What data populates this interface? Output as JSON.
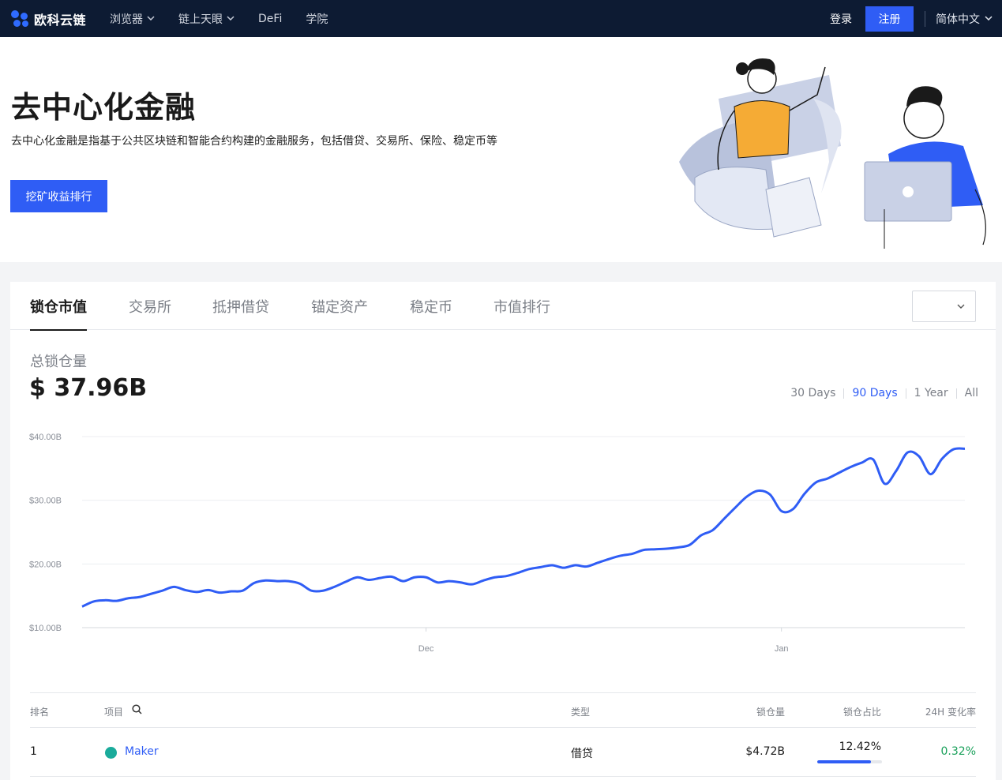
{
  "nav": {
    "brand": "欧科云链",
    "menu": [
      {
        "label": "浏览器",
        "dropdown": true
      },
      {
        "label": "链上天眼",
        "dropdown": true
      },
      {
        "label": "DeFi",
        "dropdown": false
      },
      {
        "label": "学院",
        "dropdown": false
      }
    ],
    "login": "登录",
    "signup": "注册",
    "language": "简体中文"
  },
  "hero": {
    "title": "去中心化金融",
    "description": "去中心化金融是指基于公共区块链和智能合约构建的金融服务，包括借贷、交易所、保险、稳定币等",
    "button": "挖矿收益排行"
  },
  "tabs": [
    "锁仓市值",
    "交易所",
    "抵押借贷",
    "锚定资产",
    "稳定币",
    "市值排行"
  ],
  "active_tab": 0,
  "tvl": {
    "label": "总锁仓量",
    "value": "$ 37.96B"
  },
  "ranges": [
    "30 Days",
    "90 Days",
    "1 Year",
    "All"
  ],
  "active_range": 1,
  "colors": {
    "accent": "#2f5df5",
    "nav_bg": "#0d1b33",
    "positive": "#19a05a"
  },
  "chart_data": {
    "type": "line",
    "ylim": [
      10,
      40
    ],
    "y_ticks": [
      10,
      20,
      30,
      40
    ],
    "y_tick_labels": [
      "$10.00B",
      "$20.00B",
      "$30.00B",
      "$40.00B"
    ],
    "x_tick_labels": [
      {
        "label": "Dec",
        "index": 30
      },
      {
        "label": "Jan",
        "index": 61
      }
    ],
    "grid": true,
    "series": [
      {
        "values": [
          13.3,
          14.1,
          14.3,
          14.2,
          14.6,
          14.8,
          15.3,
          15.8,
          16.4,
          15.9,
          15.6,
          15.9,
          15.5,
          15.7,
          15.8,
          17.0,
          17.4,
          17.3,
          17.3,
          16.9,
          15.8,
          15.8,
          16.4,
          17.2,
          17.9,
          17.5,
          17.8,
          18.0,
          17.3,
          17.9,
          17.9,
          17.1,
          17.3,
          17.1,
          16.8,
          17.4,
          17.9,
          18.1,
          18.6,
          19.2,
          19.5,
          19.8,
          19.4,
          19.8,
          19.6,
          20.2,
          20.8,
          21.3,
          21.6,
          22.2,
          22.3,
          22.4,
          22.6,
          23.0,
          24.5,
          25.3,
          27.1,
          28.9,
          30.6,
          31.5,
          30.9,
          28.3,
          28.6,
          31.0,
          32.8,
          33.4,
          34.3,
          35.2,
          35.9,
          36.4,
          32.6,
          34.6,
          37.5,
          36.9,
          34.1,
          36.5,
          38.0,
          38.1
        ]
      }
    ]
  },
  "table": {
    "headers": {
      "rank": "排名",
      "project": "项目",
      "type": "类型",
      "tvl": "锁仓量",
      "share": "锁仓占比",
      "change": "24H 变化率"
    },
    "rows": [
      {
        "rank": "1",
        "project": "Maker",
        "type": "借贷",
        "tvl": "$4.72B",
        "share": "12.42%",
        "share_value": 0.1242,
        "change": "0.32%"
      }
    ]
  }
}
